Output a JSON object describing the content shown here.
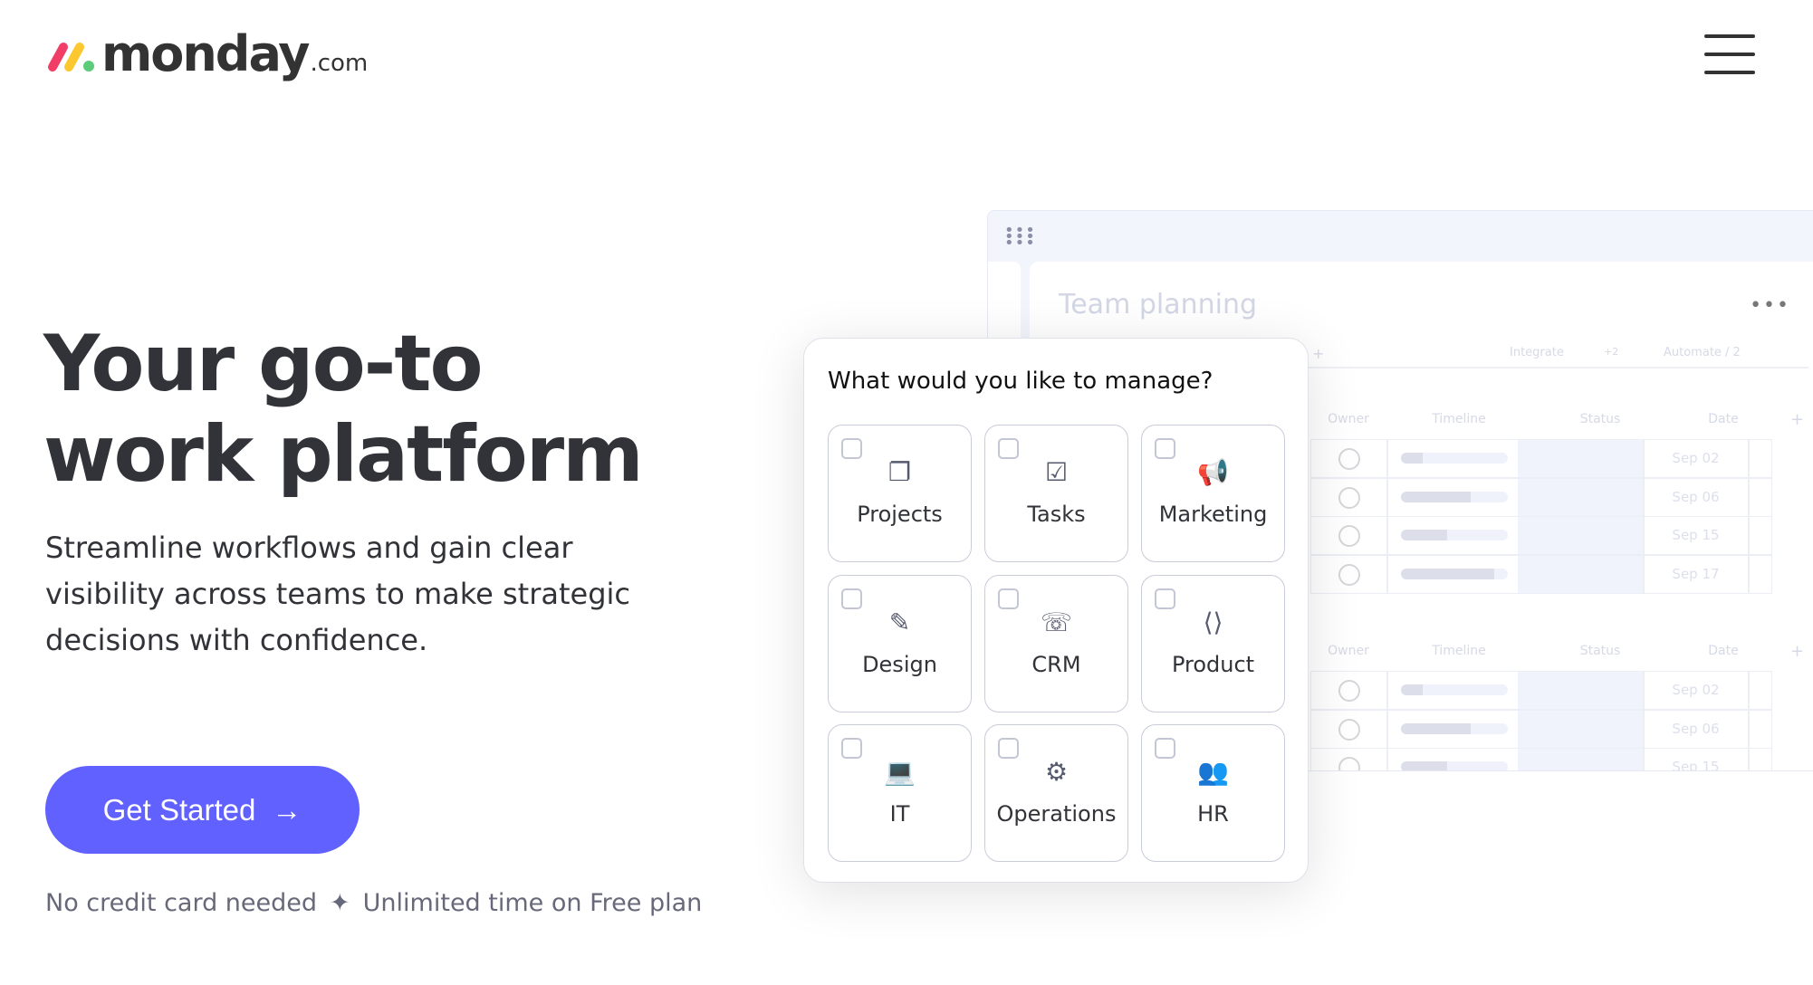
{
  "header": {
    "logo_word": "monday",
    "logo_suffix": ".com",
    "logo_colors": [
      "#f03e66",
      "#fcc72f",
      "#5bcc7a"
    ],
    "menu_icon": "hamburger-icon"
  },
  "hero": {
    "headline_line1": "Your go-to",
    "headline_line2": "work platform",
    "subtitle": "Streamline workflows and gain clear visibility across teams to make strategic decisions with confidence.",
    "cta_label": "Get Started",
    "cta_color": "#6161ff",
    "note_left": "No credit card needed",
    "note_separator": "✦",
    "note_right": "Unlimited time on Free plan"
  },
  "board": {
    "title": "Team planning",
    "tab_add": "+",
    "integrate": "Integrate",
    "integrate_more": "+2",
    "automate": "Automate / 2",
    "columns": [
      "Owner",
      "Timeline",
      "Status",
      "Date"
    ],
    "add_column": "+",
    "groups": [
      {
        "rows": [
          {
            "progress": 0.2,
            "date": "Sep 02"
          },
          {
            "progress": 0.65,
            "date": "Sep 06"
          },
          {
            "progress": 0.43,
            "date": "Sep 15"
          },
          {
            "progress": 0.87,
            "date": "Sep 17"
          }
        ]
      },
      {
        "rows": [
          {
            "progress": 0.2,
            "date": "Sep 02"
          },
          {
            "progress": 0.65,
            "date": "Sep 06"
          },
          {
            "progress": 0.43,
            "date": "Sep 15"
          }
        ]
      }
    ]
  },
  "modal": {
    "question": "What would you like to manage?",
    "options": [
      {
        "label": "Projects",
        "icon": "projects-icon",
        "glyph": "❐"
      },
      {
        "label": "Tasks",
        "icon": "checklist-icon",
        "glyph": "☑"
      },
      {
        "label": "Marketing",
        "icon": "megaphone-icon",
        "glyph": "📢"
      },
      {
        "label": "Design",
        "icon": "design-icon",
        "glyph": "✎"
      },
      {
        "label": "CRM",
        "icon": "crm-icon",
        "glyph": "☏"
      },
      {
        "label": "Product",
        "icon": "product-icon",
        "glyph": "⟨⟩"
      },
      {
        "label": "IT",
        "icon": "laptop-icon",
        "glyph": "💻"
      },
      {
        "label": "Operations",
        "icon": "gear-icon",
        "glyph": "⚙"
      },
      {
        "label": "HR",
        "icon": "people-icon",
        "glyph": "👥"
      }
    ]
  }
}
